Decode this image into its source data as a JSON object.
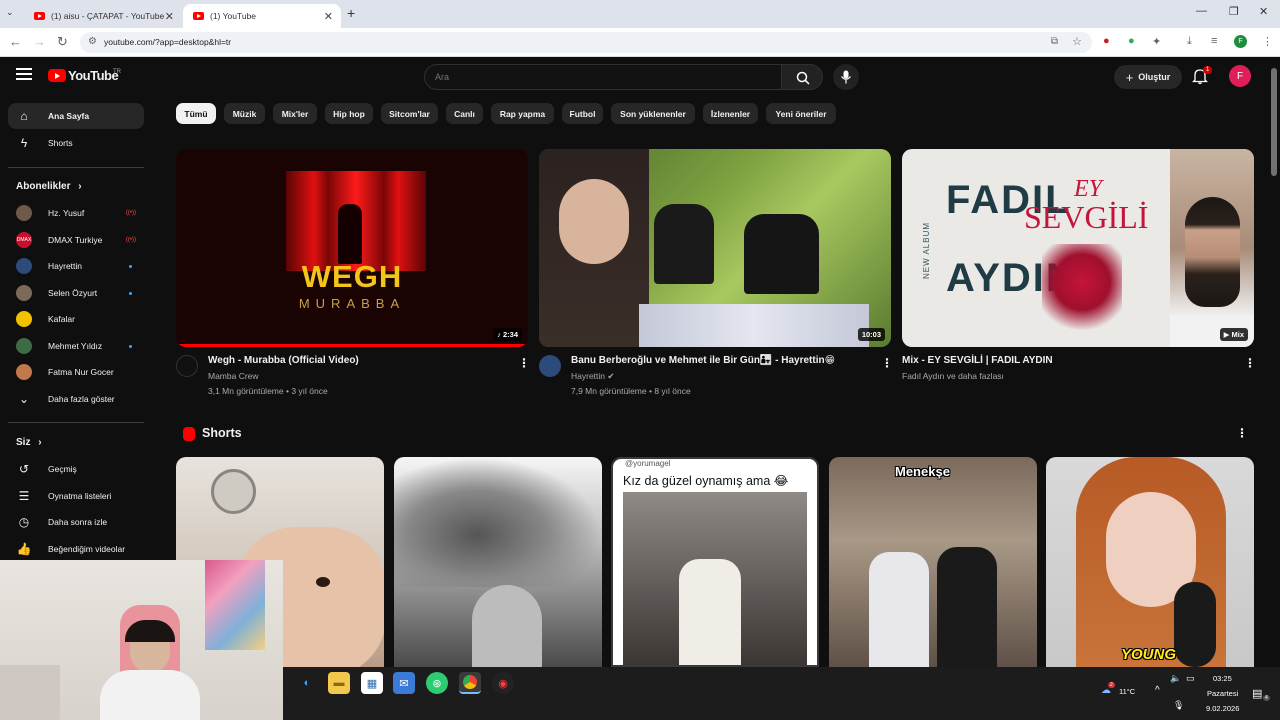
{
  "browser": {
    "tabs": [
      {
        "title": "(1) aisu - ÇATAPAT - YouTube"
      },
      {
        "title": "(1) YouTube"
      }
    ],
    "url": "youtube.com/?app=desktop&hl=tr"
  },
  "header": {
    "logo": "YouTube",
    "region": "TR",
    "search_placeholder": "Ara",
    "create_label": "Oluştur",
    "notifications": "1",
    "avatar_letter": "F"
  },
  "sidebar": {
    "home": "Ana Sayfa",
    "shorts": "Shorts",
    "subscriptions_title": "Abonelikler",
    "subscriptions": [
      {
        "name": "Hz. Yusuf",
        "status": "live"
      },
      {
        "name": "DMAX Turkiye",
        "status": "live"
      },
      {
        "name": "Hayrettin",
        "status": "new"
      },
      {
        "name": "Selen Özyurt",
        "status": "new"
      },
      {
        "name": "Kafalar",
        "status": ""
      },
      {
        "name": "Mehmet Yıldız",
        "status": "new"
      },
      {
        "name": "Fatma Nur Gocer",
        "status": ""
      }
    ],
    "show_more": "Daha fazla göster",
    "you_title": "Siz",
    "you_items": [
      "Geçmiş",
      "Oynatma listeleri",
      "Daha sonra izle",
      "Beğendiğim videolar"
    ]
  },
  "chips": [
    "Tümü",
    "Müzik",
    "Mix'ler",
    "Hip hop",
    "Sitcom'lar",
    "Canlı",
    "Rap yapma",
    "Futbol",
    "Son yüklenenler",
    "İzlenenler",
    "Yeni öneriler"
  ],
  "videos": [
    {
      "title": "Wegh -  Murabba (Official Video)",
      "channel": "Mamba Crew",
      "views": "3,1 Mn görüntüleme",
      "age": "3 yıl önce",
      "duration": "2:34",
      "thumb_text_1": "WEGH",
      "thumb_text_2": "MURABBA"
    },
    {
      "title": "Banu Berberoğlu ve Mehmet ile Bir Gün👨‍👧 - Hayrettin😁",
      "channel": "Hayrettin",
      "views": "7,9 Mn görüntüleme",
      "age": "8 yıl önce",
      "duration": "10:03"
    },
    {
      "title": "Mix - EY SEVGİLİ | FADIL AYDIN",
      "channel": "Fadıl Aydın ve daha fazlası",
      "duration": "Mix",
      "thumb_text_1": "FADIL",
      "thumb_text_2": "AYDIN",
      "thumb_text_3": "EY",
      "thumb_text_4": "SEVGİLİ",
      "thumb_text_5": "NEW ALBUM"
    }
  ],
  "shorts": {
    "title": "Shorts",
    "items": [
      {
        "caption": ""
      },
      {
        "caption": ""
      },
      {
        "caption": "Kız da güzel oynamış ama 😂",
        "handle": "@yorumagel"
      },
      {
        "caption": "Menekşe"
      },
      {
        "caption": "YOUNG"
      }
    ]
  },
  "taskbar": {
    "weather": "11°C",
    "time": "03:25",
    "day": "Pazartesi",
    "date": "9.02.2026",
    "weather_badge": "2",
    "notif_badge": "4"
  },
  "colors": {
    "background": "#0f0f0f",
    "accent": "#ff0000",
    "avatar": "#e01e5a",
    "link": "#3ea6ff"
  }
}
